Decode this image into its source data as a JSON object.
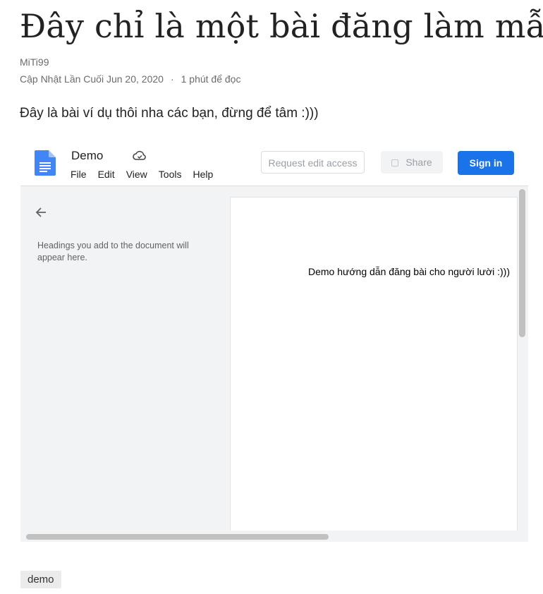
{
  "post": {
    "title": "Đây chỉ là một bài đăng làm mẫu",
    "author": "MiTi99",
    "updated_label": "Cập Nhật Lần Cuối Jun 20, 2020",
    "separator": "·",
    "read_time": "1 phút để đọc",
    "intro": "Đây là bài ví dụ thôi nha các bạn, đừng để tâm :)))"
  },
  "doc_embed": {
    "icons": {
      "logo": "google-docs-logo",
      "cloud": "cloud-saved-icon",
      "back": "arrow-back-icon",
      "lock": "lock-icon"
    },
    "doc_name": "Demo",
    "menu": [
      "File",
      "Edit",
      "View",
      "Tools",
      "Help"
    ],
    "request_edit_label": "Request edit access",
    "share_label": "Share",
    "signin_label": "Sign in",
    "outline_hint": "Headings you add to the document will appear here.",
    "page_text": "Demo hướng dẫn đăng bài cho người lười :)))",
    "colors": {
      "accent": "#1a73e8",
      "docs_blue": "#4285f4"
    }
  },
  "tags": [
    "demo"
  ]
}
